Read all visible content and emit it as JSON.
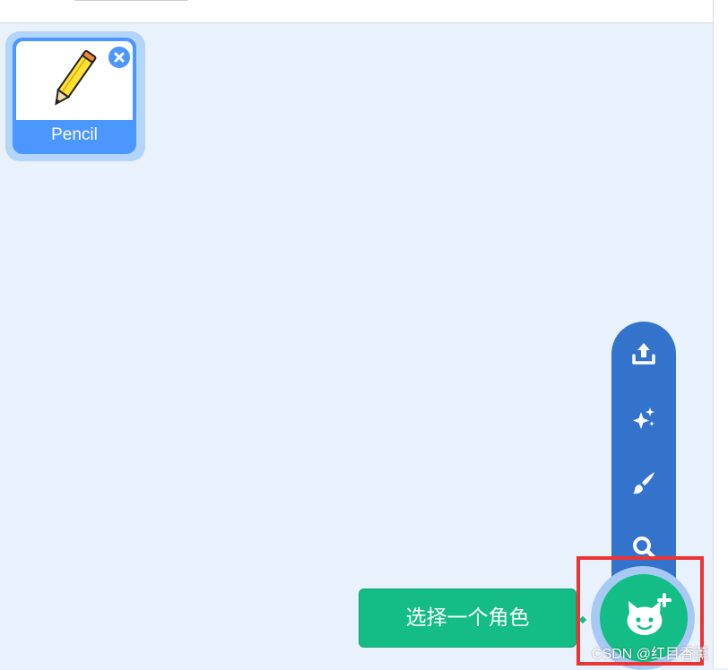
{
  "sprite_pane": {
    "sprites": [
      {
        "name": "Pencil",
        "thumbnail_icon": "pencil-icon",
        "delete_icon": "close-icon",
        "selected": true
      }
    ]
  },
  "sprite_menu": {
    "items": [
      {
        "icon": "upload-icon"
      },
      {
        "icon": "surprise-sparkle-icon"
      },
      {
        "icon": "paint-brush-icon"
      },
      {
        "icon": "search-icon"
      }
    ],
    "main_button_icon": "cat-add-icon",
    "tooltip": "选择一个角色"
  },
  "annotation": {
    "highlight_color": "#ee3333"
  },
  "watermark": "CSDN @红目香薰",
  "colors": {
    "pane_background": "#e9f1fc",
    "sprite_selected": "#4c97ff",
    "menu_column": "#3373cc",
    "main_button": "#14bd85"
  }
}
